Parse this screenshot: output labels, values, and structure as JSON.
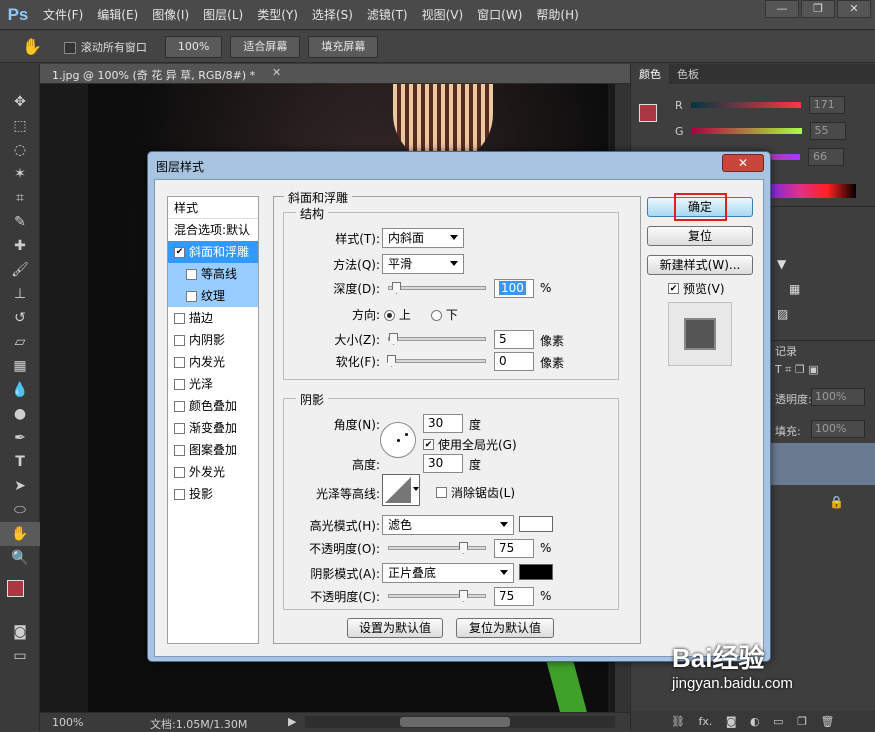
{
  "app": {
    "logo": "Ps"
  },
  "menu": [
    "文件(F)",
    "编辑(E)",
    "图像(I)",
    "图层(L)",
    "类型(Y)",
    "选择(S)",
    "滤镜(T)",
    "视图(V)",
    "窗口(W)",
    "帮助(H)"
  ],
  "options": {
    "scroll_all": "滚动所有窗口",
    "zoom_100": "100%",
    "fit_screen": "适合屏幕",
    "fill_screen": "填充屏幕"
  },
  "document": {
    "tab_title": "1.jpg @ 100% (奇 花 异 草, RGB/8#) *"
  },
  "status": {
    "zoom": "100%",
    "doc_size": "文档:1.05M/1.30M"
  },
  "color_panel": {
    "tabs": [
      "颜色",
      "色板"
    ],
    "r_label": "R",
    "g_label": "G",
    "r_value": "171",
    "g_value": "55",
    "b_value": "66",
    "fg_color": "#ab3742"
  },
  "layers_panel": {
    "history_tab": "记录",
    "opacity_label": "透明度:",
    "opacity_value": "100%",
    "fill_label": "填充:",
    "fill_value": "100%"
  },
  "dialog": {
    "title": "图层样式",
    "close": "✕",
    "styles_header": "样式",
    "blend_options": "混合选项:默认",
    "items": [
      {
        "label": "斜面和浮雕",
        "checked": true,
        "state": "sel"
      },
      {
        "label": "等高线",
        "checked": false,
        "state": "sub"
      },
      {
        "label": "纹理",
        "checked": false,
        "state": "sub"
      },
      {
        "label": "描边",
        "checked": false,
        "state": ""
      },
      {
        "label": "内阴影",
        "checked": false,
        "state": ""
      },
      {
        "label": "内发光",
        "checked": false,
        "state": ""
      },
      {
        "label": "光泽",
        "checked": false,
        "state": ""
      },
      {
        "label": "颜色叠加",
        "checked": false,
        "state": ""
      },
      {
        "label": "渐变叠加",
        "checked": false,
        "state": ""
      },
      {
        "label": "图案叠加",
        "checked": false,
        "state": ""
      },
      {
        "label": "外发光",
        "checked": false,
        "state": ""
      },
      {
        "label": "投影",
        "checked": false,
        "state": ""
      }
    ],
    "panel_title": "斜面和浮雕",
    "structure": {
      "title": "结构",
      "style_label": "样式(T):",
      "style_value": "内斜面",
      "technique_label": "方法(Q):",
      "technique_value": "平滑",
      "depth_label": "深度(D):",
      "depth_value": "100",
      "depth_unit": "%",
      "direction_label": "方向:",
      "dir_up": "上",
      "dir_down": "下",
      "size_label": "大小(Z):",
      "size_value": "5",
      "size_unit": "像素",
      "soften_label": "软化(F):",
      "soften_value": "0",
      "soften_unit": "像素"
    },
    "shading": {
      "title": "阴影",
      "angle_label": "角度(N):",
      "angle_value": "30",
      "angle_unit": "度",
      "global_light": "使用全局光(G)",
      "altitude_label": "高度:",
      "altitude_value": "30",
      "altitude_unit": "度",
      "gloss_label": "光泽等高线:",
      "antialias": "消除锯齿(L)",
      "highlight_label": "高光模式(H):",
      "highlight_value": "滤色",
      "hl_opacity_label": "不透明度(O):",
      "hl_opacity_value": "75",
      "hl_opacity_unit": "%",
      "shadow_label": "阴影模式(A):",
      "shadow_value": "正片叠底",
      "sh_opacity_label": "不透明度(C):",
      "sh_opacity_value": "75",
      "sh_opacity_unit": "%"
    },
    "set_default": "设置为默认值",
    "reset_default": "复位为默认值",
    "ok": "确定",
    "reset": "复位",
    "new_style": "新建样式(W)...",
    "preview": "预览(V)"
  },
  "watermark": {
    "brand": "Bai经验",
    "url": "jingyan.baidu.com"
  }
}
